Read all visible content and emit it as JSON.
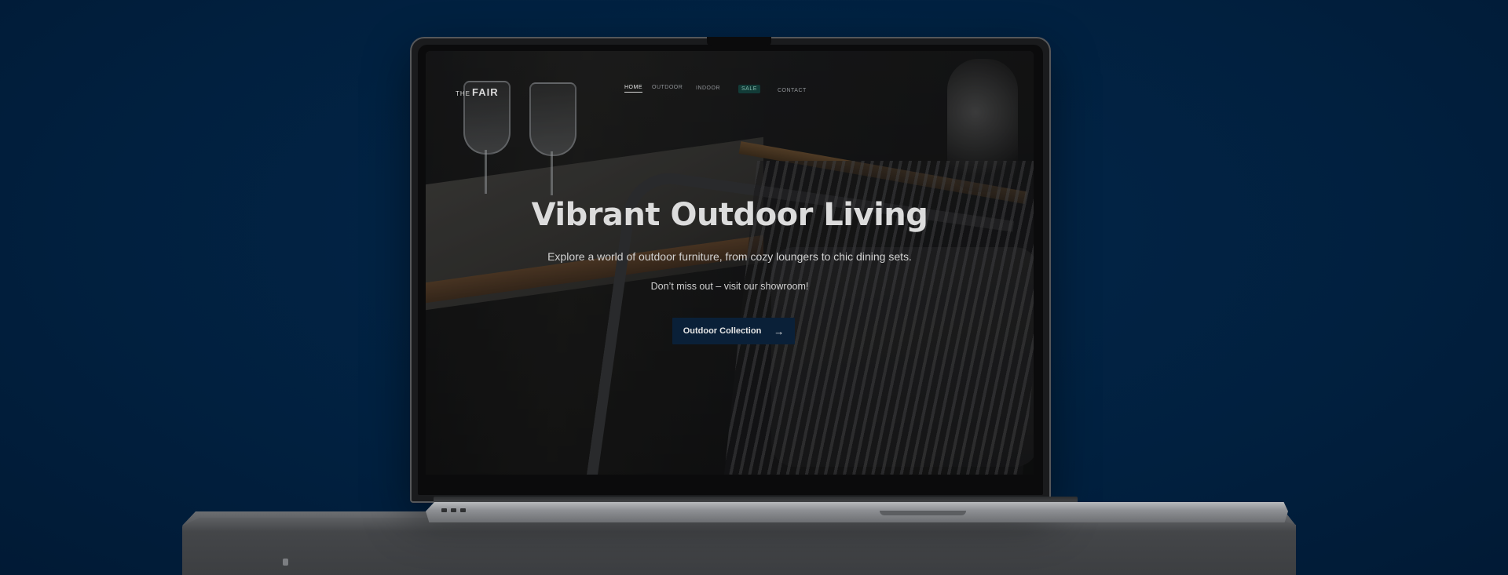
{
  "site": {
    "logo_prefix": "THE",
    "logo_name": "FAIR"
  },
  "nav": {
    "items": [
      {
        "label": "HOME",
        "state": "active"
      },
      {
        "label": "OUTDOOR",
        "state": "default"
      },
      {
        "label": "INDOOR",
        "state": "default"
      },
      {
        "label": "SALE",
        "state": "highlight"
      },
      {
        "label": "CONTACT",
        "state": "default"
      }
    ]
  },
  "hero": {
    "title": "Vibrant Outdoor Living",
    "subtitle": "Explore a world of outdoor furniture, from cozy loungers to chic dining sets.",
    "tagline": "Don’t miss out – visit our showroom!",
    "cta_label": "Outdoor Collection",
    "cta_icon": "arrow-right-icon"
  },
  "colors": {
    "background": "#01203f",
    "cta_background": "#0a2038",
    "sale_badge": "#123b37"
  }
}
